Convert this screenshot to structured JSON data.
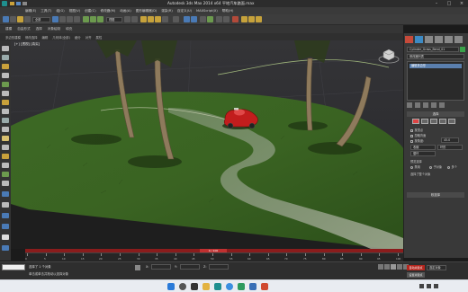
{
  "window": {
    "title": "Autodesk 3ds Max  2014 x64     平地汽车路面.max"
  },
  "menubar": {
    "items": [
      "编辑(E)",
      "工具(T)",
      "组(G)",
      "视图(V)",
      "创建(C)",
      "修改器(M)",
      "动画(A)",
      "图形编辑器(D)",
      "渲染(R)",
      "自定义(U)",
      "MAXScript(X)",
      "帮助(H)"
    ]
  },
  "toolbar": {
    "selection_filter": "全部",
    "view_dropdown": "视图"
  },
  "ribbon": {
    "tabs": [
      "建模",
      "自由形式",
      "选择",
      "对象绘制",
      "填充"
    ],
    "subtabs": [
      "多边形建模",
      "修改选择",
      "编辑",
      "几何体(全部)",
      "细分",
      "对齐",
      "属性"
    ]
  },
  "viewport": {
    "label": "[+] [透视] [真实]"
  },
  "command_panel": {
    "object_name": "Cylinder_Grass_Bend_01",
    "modifier_list": "修改器列表",
    "stack_item": "编辑多边形",
    "section1": "选择",
    "section2": "软选择",
    "checks": [
      "按顶点",
      "忽略背面",
      "按角度:",
      "收缩",
      "环形",
      "循环"
    ],
    "angle_value": "45.0",
    "preview_label": "预览选择",
    "preview_options": [
      "禁用",
      "子对象",
      "多个"
    ],
    "status_text": "选择了整个对象"
  },
  "timeline": {
    "slider": "0 / 100",
    "ticks": [
      "0",
      "5",
      "10",
      "15",
      "20",
      "25",
      "30",
      "35",
      "40",
      "45",
      "50",
      "55",
      "60",
      "65",
      "70",
      "75",
      "80",
      "85",
      "90",
      "95",
      "100"
    ]
  },
  "statusbar": {
    "message": "选择了 1 个对象",
    "hint": "单击或单击并拖动以选择对象",
    "x": "X:",
    "y": "Y:",
    "z": "Z:",
    "auto_key": "自动关键点",
    "set_key": "设置关键点",
    "selected": "选定对象"
  },
  "taskbar": {
    "time": "",
    "date": ""
  },
  "colors": {
    "timeline_red": "#8a1c1c",
    "grass": "#3f6a26",
    "car_red": "#c21d1d"
  }
}
